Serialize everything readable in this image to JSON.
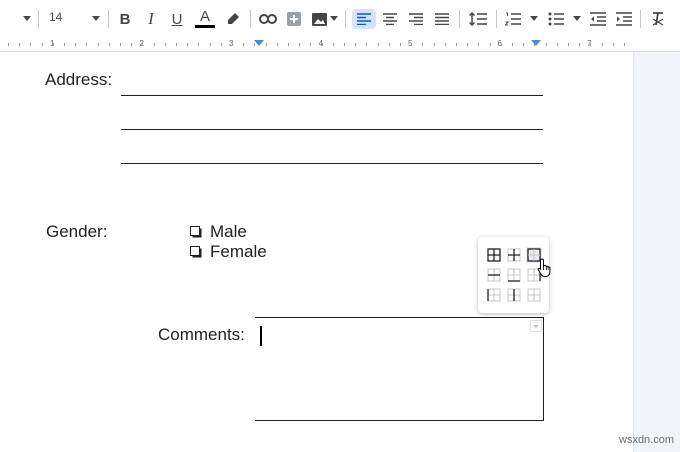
{
  "toolbar": {
    "font_size": "14",
    "items": [
      "bold",
      "italic",
      "underline",
      "text-color",
      "highlight",
      "link",
      "add-comment",
      "insert-image",
      "align-left",
      "align-center",
      "align-right",
      "justify",
      "line-spacing",
      "numbered-list",
      "bulleted-list",
      "decrease-indent",
      "increase-indent",
      "clear-formatting"
    ],
    "bold_label": "B",
    "italic_label": "I",
    "underline_label": "U",
    "text_color_label": "A",
    "text_color": "#000000",
    "active_color": "#d3e3fd",
    "marker_color": "#4a89dc"
  },
  "ruler": {
    "numbers": [
      "1",
      "2",
      "3",
      "4",
      "5",
      "6",
      "7"
    ]
  },
  "document": {
    "address_label": "Address:",
    "gender_label": "Gender:",
    "options": [
      "Male",
      "Female"
    ],
    "comments_label": "Comments:"
  },
  "border_popup": {
    "options": [
      "all-borders",
      "inner-borders",
      "outer-borders",
      "inner-horizontal-border",
      "bottom-border",
      "top-border",
      "left-border",
      "vertical-inner-border",
      "right-border"
    ],
    "selected": "outer-borders"
  },
  "watermark": "wsxdn.com"
}
